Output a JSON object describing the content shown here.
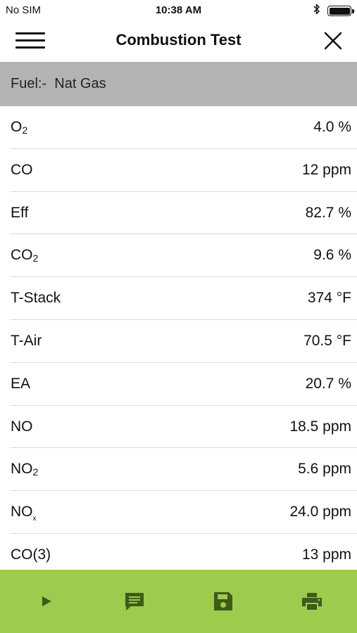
{
  "status_bar": {
    "carrier": "No SIM",
    "time": "10:38 AM",
    "icons": [
      "bluetooth-icon",
      "battery-icon"
    ]
  },
  "nav": {
    "title": "Combustion Test",
    "left_icon": "menu-icon",
    "right_icon": "close-icon"
  },
  "fuel": {
    "label": "Fuel:-",
    "value": "Nat Gas"
  },
  "readings": [
    {
      "name": "O",
      "sub": "2",
      "value": "4.0 %"
    },
    {
      "name": "CO",
      "sub": "",
      "value": "12 ppm"
    },
    {
      "name": "Eff",
      "sub": "",
      "value": "82.7 %"
    },
    {
      "name": "CO",
      "sub": "2",
      "value": "9.6 %"
    },
    {
      "name": "T-Stack",
      "sub": "",
      "value": "374 °F"
    },
    {
      "name": "T-Air",
      "sub": "",
      "value": "70.5 °F"
    },
    {
      "name": "EA",
      "sub": "",
      "value": "20.7 %"
    },
    {
      "name": "NO",
      "sub": "",
      "value": "18.5 ppm"
    },
    {
      "name": "NO",
      "sub": "2",
      "value": "5.6 ppm"
    },
    {
      "name": "NO",
      "sub": "x",
      "value": "24.0 ppm"
    },
    {
      "name": "CO(3)",
      "sub": "",
      "value": "13 ppm"
    }
  ],
  "toolbar": {
    "background": "#9ccb4d",
    "icon_color": "#3f5a1a",
    "icons": [
      "play-icon",
      "comment-icon",
      "save-icon",
      "print-icon"
    ]
  }
}
